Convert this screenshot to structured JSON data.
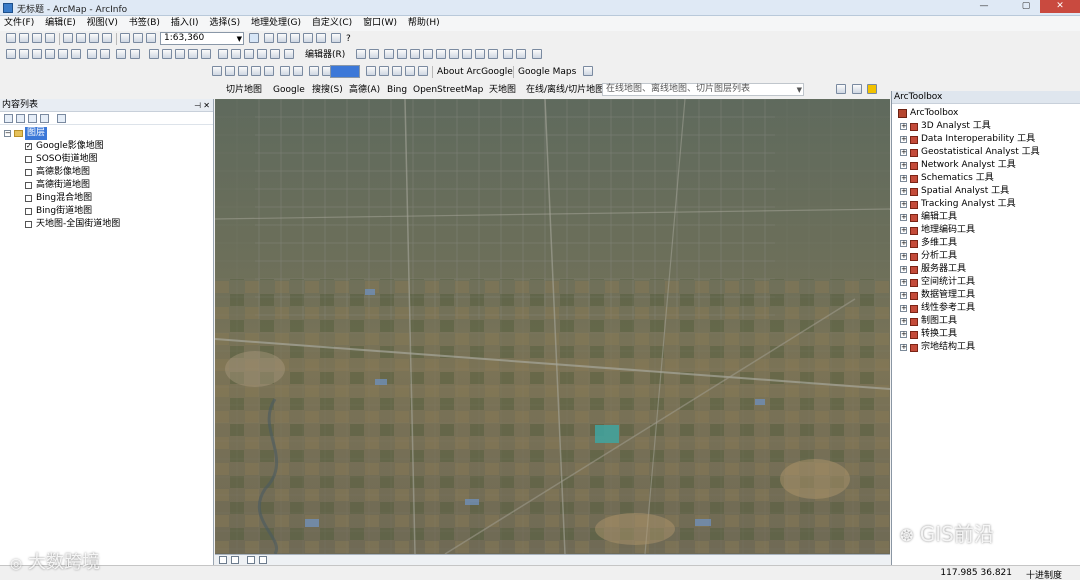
{
  "window": {
    "title": "无标题 - ArcMap - ArcInfo",
    "min": "—",
    "max": "▢",
    "close": "✕"
  },
  "menu": [
    "文件(F)",
    "编辑(E)",
    "视图(V)",
    "书签(B)",
    "插入(I)",
    "选择(S)",
    "地理处理(G)",
    "自定义(C)",
    "窗口(W)",
    "帮助(H)"
  ],
  "toolbar": {
    "scale": "1:63,360",
    "editor": "编辑器(R)",
    "about_arcgoogle": "About ArcGoogle",
    "google_maps": "Google Maps"
  },
  "tile_toolbar": {
    "items": [
      "切片地图",
      "Google",
      "搜搜(S)",
      "高德(A)",
      "Bing",
      "OpenStreetMap",
      "天地图"
    ],
    "online_label": "在线/离线/切片地图:",
    "online_placeholder": "在线地图、离线地图、切片图层列表"
  },
  "toc": {
    "title": "内容列表",
    "root": "图层",
    "layers": [
      {
        "label": "Google影像地图",
        "checked": true
      },
      {
        "label": "SOSO街道地图",
        "checked": false
      },
      {
        "label": "高德影像地图",
        "checked": false
      },
      {
        "label": "高德街道地图",
        "checked": false
      },
      {
        "label": "Bing混合地图",
        "checked": false
      },
      {
        "label": "Bing街道地图",
        "checked": false
      },
      {
        "label": "天地图-全国街道地图",
        "checked": false
      }
    ]
  },
  "toolbox": {
    "title": "ArcToolbox",
    "root": "ArcToolbox",
    "items": [
      "3D Analyst 工具",
      "Data Interoperability 工具",
      "Geostatistical Analyst 工具",
      "Network Analyst 工具",
      "Schematics 工具",
      "Spatial Analyst 工具",
      "Tracking Analyst 工具",
      "编辑工具",
      "地理编码工具",
      "多维工具",
      "分析工具",
      "服务器工具",
      "空间统计工具",
      "数据管理工具",
      "线性参考工具",
      "制图工具",
      "转换工具",
      "宗地结构工具"
    ]
  },
  "status": {
    "coords": "117.985  36.821",
    "units": "十进制度"
  },
  "watermarks": {
    "left": "大数跨境",
    "right": "GIS前沿"
  }
}
